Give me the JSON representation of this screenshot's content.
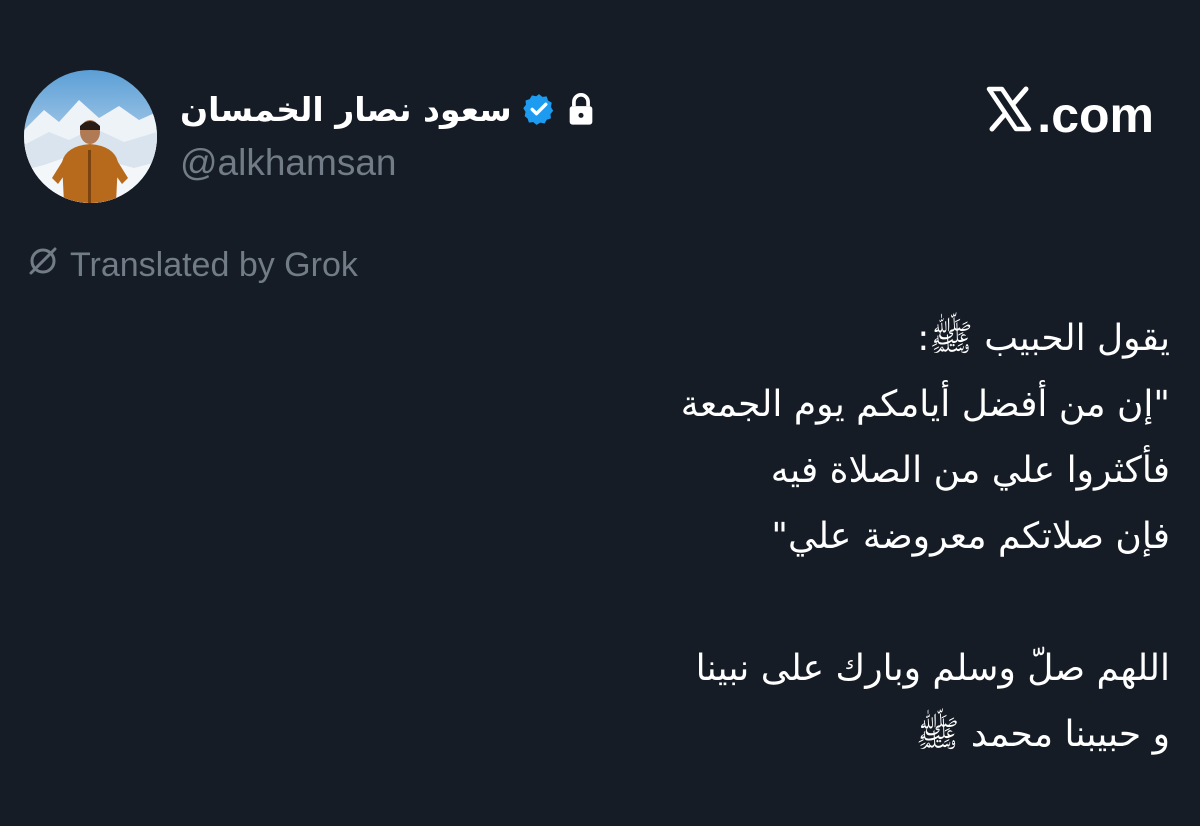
{
  "site": {
    "label": ".com",
    "logo_icon": "x-logo-icon"
  },
  "user": {
    "display_name": "سعود نصار الخمسان",
    "handle": "@alkhamsan",
    "verified_icon": "verified-badge-icon",
    "lock_icon": "lock-icon",
    "avatar": "profile-photo"
  },
  "translation": {
    "icon": "grok-icon",
    "text": "Translated by Grok"
  },
  "tweet": {
    "lines": [
      "يقول الحبيب ﷺ:",
      "\"إن من أفضل أيامكم يوم الجمعة",
      "فأكثروا علي من الصلاة فيه",
      "فإن صلاتكم معروضة علي\"",
      "",
      "اللهم صلّ وسلم وبارك على نبينا",
      "و حبيبنا محمد ﷺ"
    ]
  },
  "colors": {
    "background": "#151c25",
    "text": "#ffffff",
    "muted": "#727c86",
    "verified": "#1d9bf0"
  }
}
